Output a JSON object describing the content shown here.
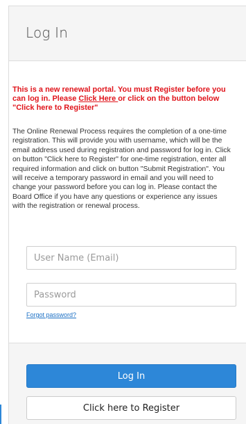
{
  "header": {
    "title": "Log In"
  },
  "notice": {
    "part1": "This is a new renewal portal. You must Register before you can log in. Please ",
    "link": "Click Here ",
    "part2": "or click on the button below \"Click here to Register\""
  },
  "instructions": "The Online Renewal Process requires the completion of a one-time registration. This will provide you with username, which will be the email address used during registration and password for log in. Click on button \"Click here to Register\" for one-time registration, enter all required information and click on button \"Submit Registration\". You will receive a temporary password in email and you will need to change your password before you can log in. Please contact the Board Office if you have any questions or experience any issues with the registration or renewal process.",
  "form": {
    "username_placeholder": "User Name (Email)",
    "password_placeholder": "Password",
    "forgot_link": "Forgot password?"
  },
  "actions": {
    "login_label": "Log In",
    "register_label": "Click here to Register"
  },
  "colors": {
    "primary": "#2d87d8",
    "notice_red": "#e0141b",
    "link_blue": "#1a6fc4"
  }
}
